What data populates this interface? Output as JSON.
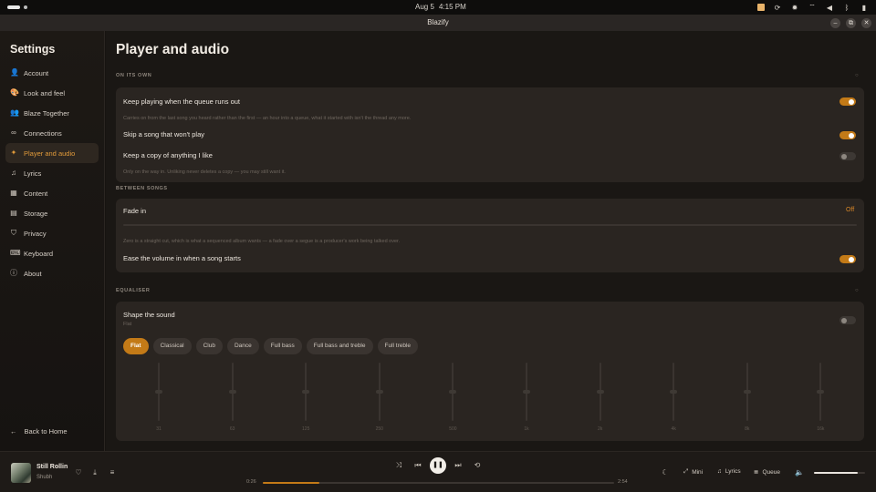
{
  "os": {
    "date": "Aug 5",
    "time": "4:15 PM",
    "tray_icons": [
      "pdf-icon",
      "refresh-icon",
      "brightness-icon",
      "wifi-icon",
      "volume-icon",
      "bluetooth-icon",
      "battery-icon"
    ]
  },
  "window": {
    "title": "Blazify",
    "controls": [
      "–",
      "⧉",
      "✕"
    ]
  },
  "sidebar": {
    "heading": "Settings",
    "items": [
      {
        "label": "Account",
        "icon": "person-icon",
        "glyph": "👤"
      },
      {
        "label": "Look and feel",
        "icon": "palette-icon",
        "glyph": "🎨"
      },
      {
        "label": "Blaze Together",
        "icon": "group-icon",
        "glyph": "👥"
      },
      {
        "label": "Connections",
        "icon": "link-icon",
        "glyph": "∞"
      },
      {
        "label": "Player and audio",
        "icon": "sparkle-icon",
        "glyph": "✦",
        "active": true
      },
      {
        "label": "Lyrics",
        "icon": "lyrics-icon",
        "glyph": "♫"
      },
      {
        "label": "Content",
        "icon": "content-icon",
        "glyph": "▦"
      },
      {
        "label": "Storage",
        "icon": "storage-icon",
        "glyph": "▤"
      },
      {
        "label": "Privacy",
        "icon": "shield-icon",
        "glyph": "⛉"
      },
      {
        "label": "Keyboard",
        "icon": "keyboard-icon",
        "glyph": "⌨"
      },
      {
        "label": "About",
        "icon": "info-icon",
        "glyph": "ⓘ"
      }
    ],
    "back_label": "Back to Home"
  },
  "main": {
    "title": "Player and audio",
    "sections": {
      "on_its_own": {
        "label": "ON ITS OWN",
        "keep_playing": {
          "title": "Keep playing when the queue runs out",
          "desc": "Carries on from the last song you heard rather than the first — an hour into a queue, what it started with isn't the thread any more.",
          "enabled": true
        },
        "skip_song": {
          "title": "Skip a song that won't play",
          "enabled": true
        },
        "keep_copy": {
          "title": "Keep a copy of anything I like",
          "desc": "Only on the way in. Unliking never deletes a copy — you may still want it.",
          "enabled": false
        }
      },
      "between_songs": {
        "label": "BETWEEN SONGS",
        "fade_in": {
          "title": "Fade in",
          "value": "Off",
          "desc": "Zero is a straight cut, which is what a sequenced album wants — a fade over a segue is a producer's work being talked over."
        },
        "ease_volume": {
          "title": "Ease the volume in when a song starts",
          "enabled": true
        }
      },
      "equaliser": {
        "label": "EQUALISER",
        "shape": {
          "title": "Shape the sound",
          "subtitle": "Flat",
          "enabled": false
        },
        "presets": [
          "Flat",
          "Classical",
          "Club",
          "Dance",
          "Full bass",
          "Full bass and treble",
          "Full treble"
        ],
        "active_preset": "Flat",
        "bands": [
          "31",
          "63",
          "125",
          "250",
          "500",
          "1k",
          "2k",
          "4k",
          "8k",
          "16k"
        ]
      }
    }
  },
  "player": {
    "title": "Still Rollin",
    "artist": "Shubh",
    "elapsed": "0:26",
    "total": "2:54",
    "progress": 0.16,
    "volume": 0.85,
    "mini_label": "Mini",
    "lyrics_label": "Lyrics",
    "queue_label": "Queue"
  }
}
